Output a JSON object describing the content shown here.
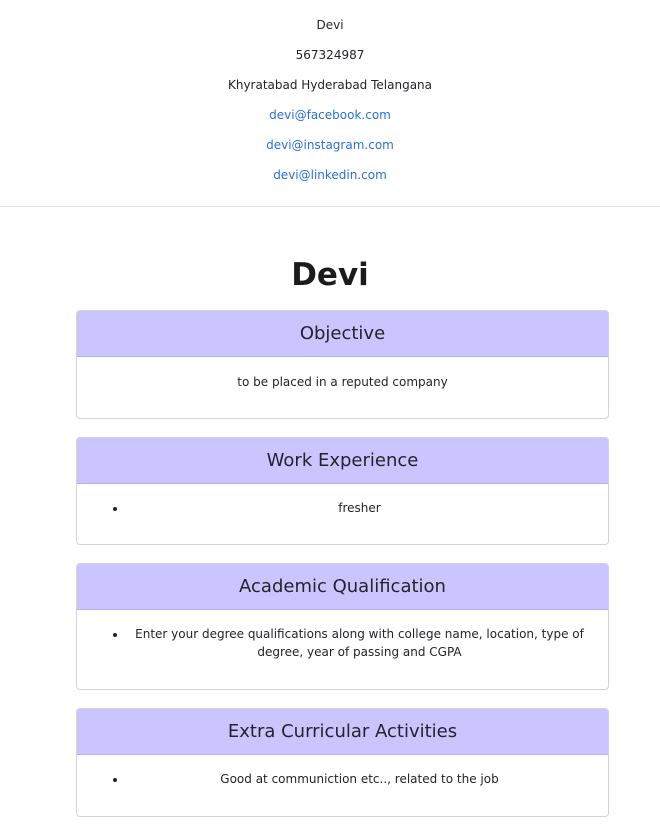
{
  "contact": {
    "name": "Devi",
    "phone": "567324987",
    "address": "Khyratabad Hyderabad Telangana",
    "links": [
      "devi@facebook.com",
      "devi@instagram.com",
      "devi@linkedin.com"
    ]
  },
  "page_title": "Devi",
  "sections": {
    "objective": {
      "title": "Objective",
      "text": "to be placed in a reputed company"
    },
    "work_experience": {
      "title": "Work Experience",
      "items": [
        "fresher"
      ]
    },
    "academic_qualification": {
      "title": "Academic Qualification",
      "items": [
        "Enter your degree qualifications along with college name, location, type of degree, year of passing and CGPA"
      ]
    },
    "extra_curricular": {
      "title": "Extra Curricular Activities",
      "items": [
        "Good at communiction etc.., related to the job"
      ]
    }
  },
  "colors": {
    "card_header_bg": "#cbc5ff",
    "link": "#2a6fd6",
    "divider": "#e3e3e3"
  }
}
